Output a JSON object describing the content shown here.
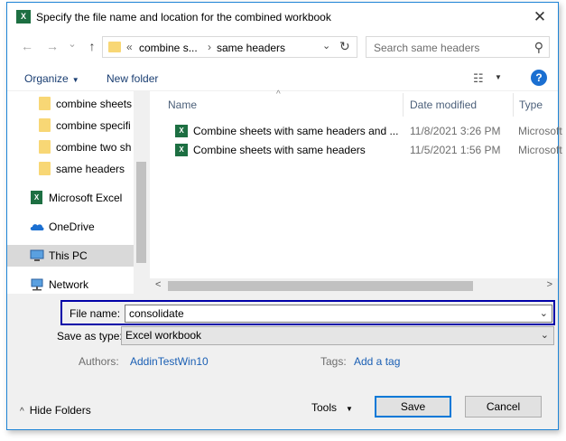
{
  "title_bar": {
    "app_icon": "excel-icon",
    "title": "Specify the file name and location for the combined workbook",
    "close_glyph": "✕"
  },
  "nav": {
    "back_glyph": "←",
    "forward_glyph": "→",
    "recent_glyph": "⌄",
    "up_glyph": "↑",
    "address": {
      "overflow": "«",
      "crumbs": [
        "combine s...",
        "same headers"
      ],
      "separator": "›",
      "dropdown_glyph": "⌄",
      "refresh_glyph": "↻"
    },
    "search_placeholder": "Search same headers",
    "search_glyph": "⚲"
  },
  "command_bar": {
    "organize": "Organize",
    "organize_caret": "▼",
    "new_folder": "New folder",
    "view_glyph": "☷",
    "view_caret": "▼",
    "help": "?"
  },
  "sidebar": {
    "items": [
      {
        "label": "combine sheets",
        "icon": "folder-icon"
      },
      {
        "label": "combine specifi",
        "icon": "folder-icon"
      },
      {
        "label": "combine two sh",
        "icon": "folder-icon"
      },
      {
        "label": "same headers",
        "icon": "folder-icon"
      },
      {
        "label": "Microsoft Excel",
        "icon": "excel-icon"
      },
      {
        "label": "OneDrive",
        "icon": "cloud-icon"
      },
      {
        "label": "This PC",
        "icon": "computer-icon",
        "selected": true
      },
      {
        "label": "Network",
        "icon": "network-icon"
      }
    ]
  },
  "file_list": {
    "sort_glyph": "^",
    "columns": [
      "Name",
      "Date modified",
      "Type"
    ],
    "rows": [
      {
        "name": "Combine sheets with same headers and ...",
        "date": "11/8/2021 3:26 PM",
        "type": "Microsoft"
      },
      {
        "name": "Combine sheets with same headers",
        "date": "11/5/2021 1:56 PM",
        "type": "Microsoft"
      }
    ],
    "scroll_left": "<",
    "scroll_right": ">"
  },
  "form": {
    "file_name_label": "File name:",
    "file_name_value": "consolidate",
    "save_as_label": "Save as type:",
    "save_as_value": "Excel workbook",
    "authors_label": "Authors:",
    "authors_value": "AddinTestWin10",
    "tags_label": "Tags:",
    "tags_value": "Add a tag",
    "chevron_glyph": "⌄"
  },
  "footer": {
    "hide_folders": "Hide Folders",
    "hide_folders_caret": "^",
    "tools": "Tools",
    "tools_caret": "▼",
    "save": "Save",
    "cancel": "Cancel"
  },
  "colors": {
    "accent": "#0078d7",
    "highlight_border": "#0000a8",
    "excel_green": "#1d6f42",
    "folder_yellow": "#f8d775"
  }
}
